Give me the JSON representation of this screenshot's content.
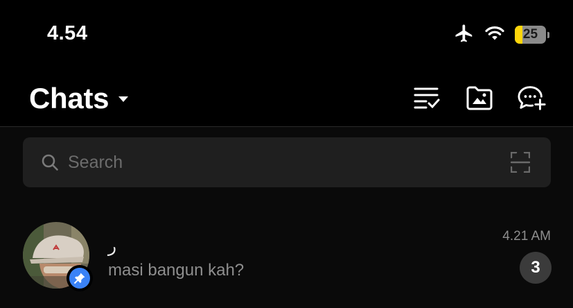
{
  "status_bar": {
    "time": "4.54",
    "battery_level": "25",
    "battery_fraction": 0.25,
    "icons": [
      "airplane-icon",
      "wifi-icon",
      "battery-icon"
    ]
  },
  "header": {
    "title": "Chats",
    "actions": [
      "edit-list-icon",
      "folder-icon",
      "new-chat-icon"
    ]
  },
  "search": {
    "placeholder": "Search"
  },
  "chats": [
    {
      "name": "ر",
      "preview": "masi bangun kah?",
      "time": "4.21 AM",
      "unread": "3",
      "pinned": true
    }
  ],
  "colors": {
    "background": "#0a0a0a",
    "pin": "#3a82f7",
    "battery_fill": "#ffd60a"
  }
}
